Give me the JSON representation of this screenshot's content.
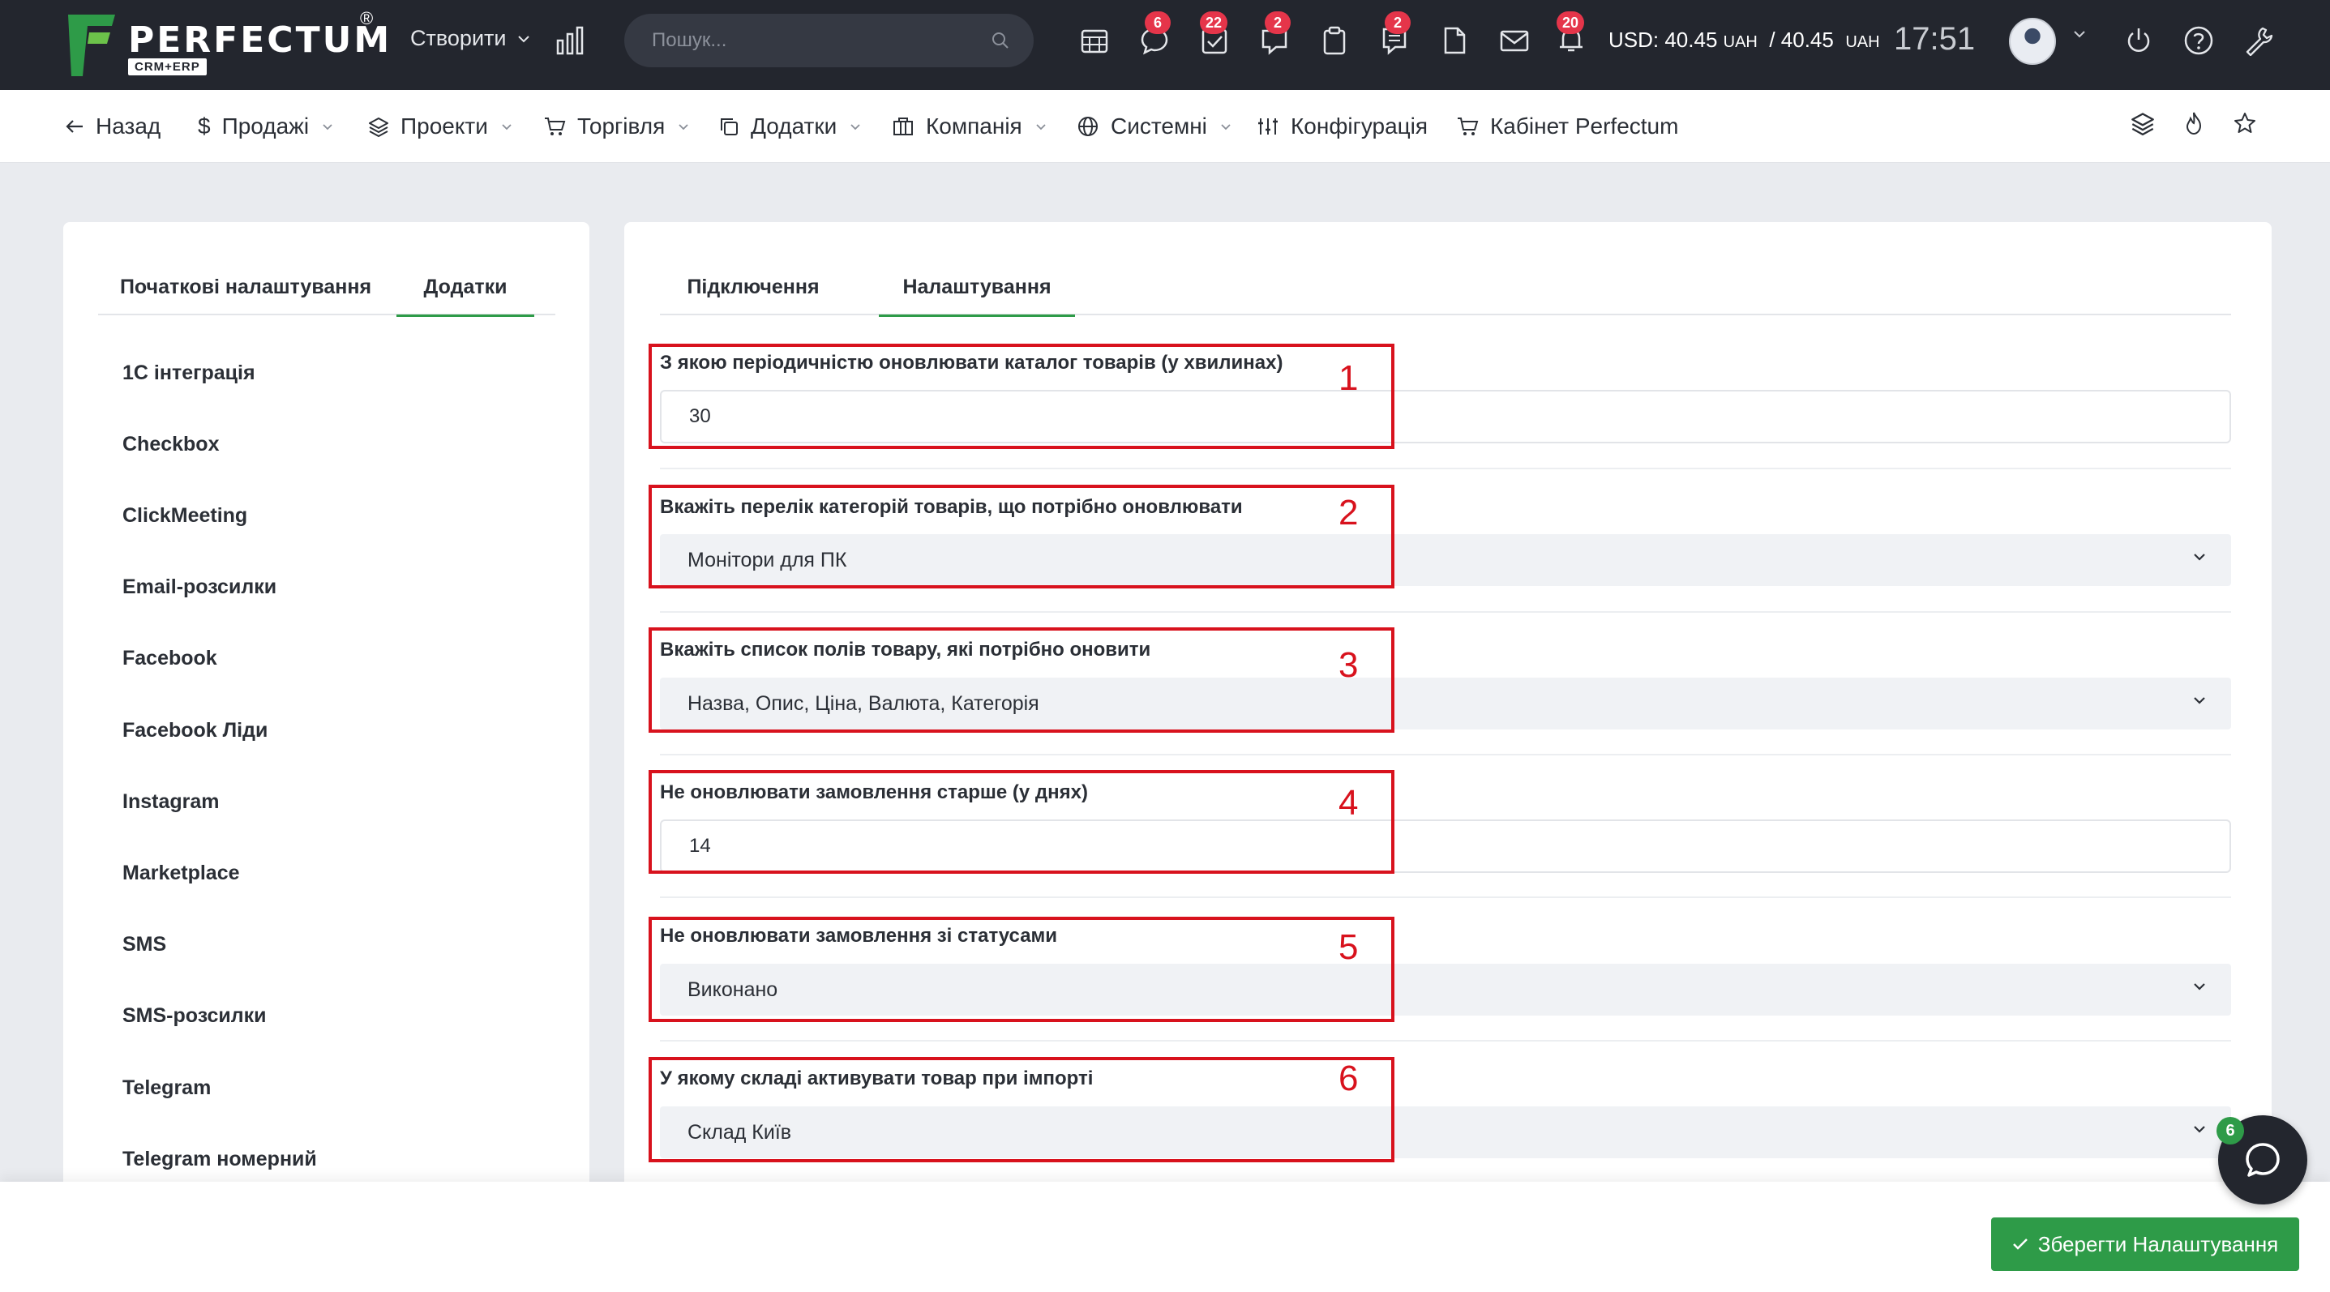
{
  "topbar": {
    "logo_text": "PERFECTUM",
    "logo_sub": "CRM+ERP",
    "logo_reg": "®",
    "create_label": "Створити",
    "search_placeholder": "Пошук...",
    "badges": {
      "chat": "6",
      "tasks": "22",
      "comments": "2",
      "notes": "2",
      "notifications": "20"
    },
    "currency_usd": "USD: 40.45",
    "currency_unit1": "UAH",
    "currency_sep": " / 40.45 ",
    "currency_unit2": "UAH",
    "time": "17:51"
  },
  "nav": {
    "back": "Назад",
    "sales": "Продажі",
    "projects": "Проекти",
    "trade": "Торгівля",
    "addons": "Додатки",
    "company": "Компанія",
    "system": "Системні",
    "config": "Конфігурація",
    "cabinet": "Кабінет Perfectum"
  },
  "left_panel": {
    "tabs": [
      "Початкові налаштування",
      "Додатки"
    ],
    "active_tab": "Додатки",
    "items": [
      "1С інтеграція",
      "Checkbox",
      "ClickMeeting",
      "Email-розсилки",
      "Facebook",
      "Facebook Ліди",
      "Instagram",
      "Marketplace",
      "SMS",
      "SMS-розсилки",
      "Telegram",
      "Telegram номерний"
    ]
  },
  "right_panel": {
    "tabs": [
      "Підключення",
      "Налаштування"
    ],
    "active_tab": "Налаштування",
    "fields": [
      {
        "number": "1",
        "label": "З якою періодичністю оновлювати каталог товарів (у хвилинах)",
        "value": "30",
        "type": "input"
      },
      {
        "number": "2",
        "label": "Вкажіть перелік категорій товарів, що потрібно оновлювати",
        "value": "Монітори для ПК",
        "type": "select"
      },
      {
        "number": "3",
        "label": "Вкажіть список полів товару, які потрібно оновити",
        "value": "Назва, Опис, Ціна, Валюта, Категорія",
        "type": "select"
      },
      {
        "number": "4",
        "label": "Не оновлювати замовлення старше (у днях)",
        "value": "14",
        "type": "input"
      },
      {
        "number": "5",
        "label": "Не оновлювати замовлення зі статусами",
        "value": "Виконано",
        "type": "select"
      },
      {
        "number": "6",
        "label": "У якому складі активувати товар при імпорті",
        "value": "Склад Київ",
        "type": "select"
      }
    ]
  },
  "footer": {
    "save_label": "Зберегти Налаштування"
  },
  "chat_badge": "6",
  "colors": {
    "topbar": "#23262e",
    "accent_green": "#2e9b48",
    "badge_red": "#e5354a",
    "annotation_red": "#d8121d"
  }
}
